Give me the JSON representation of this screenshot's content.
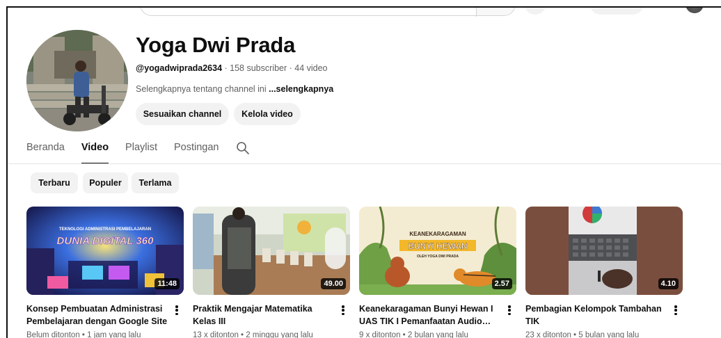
{
  "channel": {
    "name": "Yoga Dwi Prada",
    "handle": "@yogadwiprada2634",
    "stats": " · 158 subscriber · 44 video",
    "about": "Selengkapnya tentang channel ini ",
    "about_more": "...selengkapnya",
    "customize_label": "Sesuaikan channel",
    "manage_label": "Kelola video"
  },
  "tabs": [
    {
      "label": "Beranda",
      "active": false
    },
    {
      "label": "Video",
      "active": true
    },
    {
      "label": "Playlist",
      "active": false
    },
    {
      "label": "Postingan",
      "active": false
    }
  ],
  "chips": [
    "Terbaru",
    "Populer",
    "Terlama"
  ],
  "videos": [
    {
      "title": "Konsep Pembuatan Administrasi Pembelajaran dengan Google Site",
      "meta": "Belum ditonton • 1 jam yang lalu",
      "duration": "11:48",
      "thumb_text_small": "TEKNOLOGI ADMINISTRASI PEMBELAJARAN",
      "thumb_text_big": "DUNIA DIGITAL 360",
      "progress_percent": 0
    },
    {
      "title": "Praktik Mengajar Matematika Kelas III",
      "meta": "13 x ditonton • 2 minggu yang lalu",
      "duration": "49.00",
      "progress_percent": 0
    },
    {
      "title": "Keanekaragaman Bunyi Hewan I UAS TIK I Pemanfaatan Audio…",
      "meta": "9 x ditonton • 2 bulan yang lalu",
      "duration": "2.57",
      "thumb_text_small": "KEANEKARAGAMAN",
      "thumb_text_big": "BUNYI HEWAN",
      "thumb_text_by": "OLEH YOGA DWI PRADA",
      "progress_percent": 0
    },
    {
      "title": "Pembagian Kelompok Tambahan TIK",
      "meta": "23 x ditonton • 5 bulan yang lalu",
      "duration": "4.10",
      "progress_percent": 0
    }
  ],
  "icons": {
    "tab_search": "search-icon",
    "video_menu": "more-vert-icon"
  },
  "colors": {
    "text_primary": "#0f0f0f",
    "text_secondary": "#606060",
    "chip_bg": "#f2f2f2",
    "progress_red": "#ff0033"
  }
}
